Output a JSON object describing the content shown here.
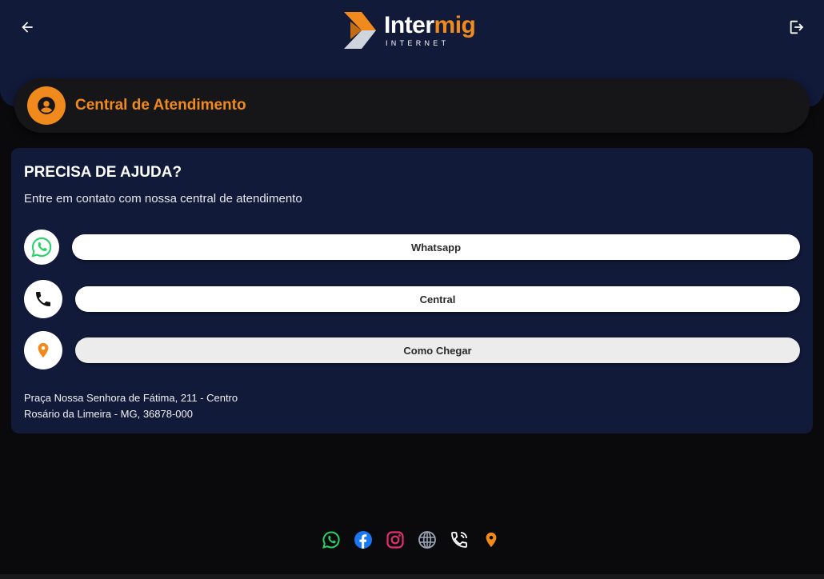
{
  "header": {
    "logo_main_white": "Inter",
    "logo_main_orange": "mig",
    "logo_sub": "INTERNET"
  },
  "page_title": "Central de Atendimento",
  "help": {
    "title": "PRECISA DE AJUDA?",
    "subtitle": "Entre em contato com nossa central de atendimento",
    "buttons": [
      {
        "label": "Whatsapp",
        "icon": "whatsapp-icon"
      },
      {
        "label": "Central",
        "icon": "phone-icon"
      },
      {
        "label": "Como Chegar",
        "icon": "map-pin-icon"
      }
    ],
    "address_line1": "Praça Nossa Senhora de Fátima, 211 - Centro",
    "address_line2": "Rosário da Limeira - MG, 36878-000"
  },
  "social_icons": [
    "whatsapp-icon",
    "facebook-icon",
    "instagram-icon",
    "globe-icon",
    "phone-call-icon",
    "map-pin-icon"
  ],
  "colors": {
    "background": "#0a0a0c",
    "header": "#121a3a",
    "card": "#161618",
    "accent": "#f08a1c",
    "whatsapp": "#25d366",
    "facebook": "#1877f2",
    "instagram": "#e1306c",
    "globe": "#9aa3b5"
  }
}
